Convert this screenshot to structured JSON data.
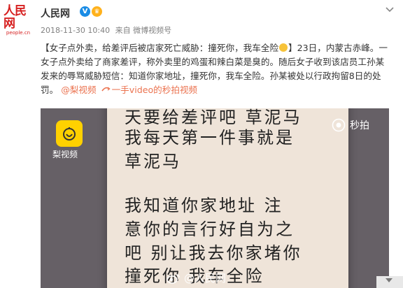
{
  "header": {
    "avatar_mark": "人民网",
    "avatar_url": "people.cn",
    "name": "人民网",
    "verified_badge": "V",
    "meta_time": "2018-11-30 10:40",
    "meta_source": "来自 微博视频号"
  },
  "post": {
    "text_1": "【女子点外卖，给差评后被店家死亡威胁：撞死你，我车全险",
    "text_2": "】23日，内蒙古赤峰。一女子点外卖给了商家差评，称外卖里的鸡蛋和辣白菜是臭的。随后女子收到该店员工孙某发来的辱骂威胁短信：知道你家地址，撞死你，我车全险。孙某被处以行政拘留8日的处罚。",
    "mention": "@梨视频",
    "link_text": "一手video的秒拍视频"
  },
  "video": {
    "note_lines": [
      "天要给差评吧 草泥马",
      "我每天第一件事就是",
      "草泥马",
      "我知道你家地址 注",
      "意你的言行好自为之",
      "吧 别让我去你家堵你",
      "撞死你 我车全险"
    ],
    "pear_label": "梨视频",
    "miaopai_label": "秒拍",
    "watermark": "@人民网"
  },
  "icons": {
    "avatar": "people-logo",
    "verified": "verified-v-icon",
    "vip": "crown-icon",
    "menu": "chevron-down-icon",
    "link": "video-link-icon",
    "emoji": "emoji-icon",
    "pear": "pear-video-logo",
    "miaopai": "miaopai-icon",
    "weibo": "weibo-icon"
  },
  "colors": {
    "link": "#eb7350",
    "verified": "#1a8ce5",
    "brand_red": "#d61f1f",
    "pear_yellow": "#ffd100"
  }
}
